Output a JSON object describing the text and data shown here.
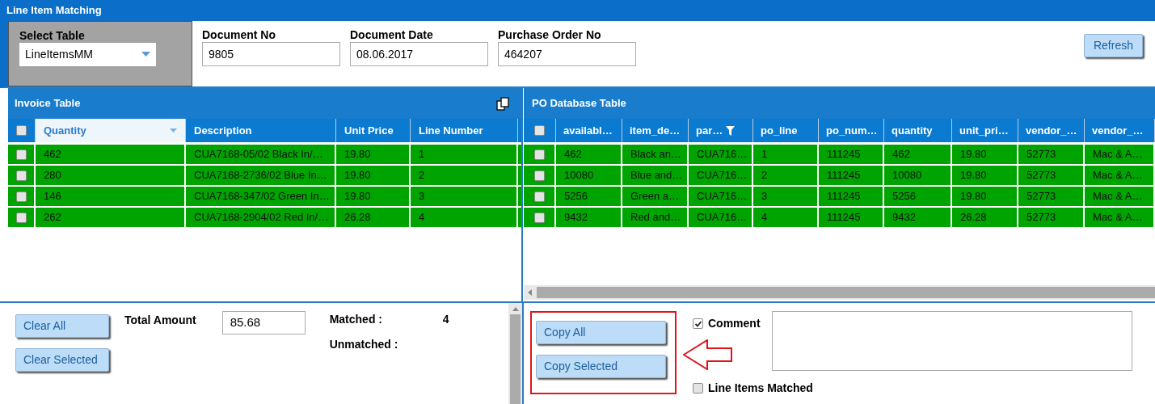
{
  "window": {
    "title": "Line Item Matching"
  },
  "select_table": {
    "label": "Select Table",
    "value": "LineItemsMM"
  },
  "fields": [
    {
      "label": "Document No",
      "value": "9805"
    },
    {
      "label": "Document Date",
      "value": "08.06.2017"
    },
    {
      "label": "Purchase Order No",
      "value": "464207"
    }
  ],
  "refresh_button": "Refresh",
  "invoice_table": {
    "title": "Invoice Table",
    "all_checked": false,
    "columns": [
      {
        "label": "Quantity",
        "active": true
      },
      {
        "label": "Description",
        "active": false
      },
      {
        "label": "Unit Price",
        "active": false
      },
      {
        "label": "Line Number",
        "active": false
      }
    ],
    "rows": [
      {
        "checked": false,
        "matched": true,
        "cells": [
          "462",
          "CUA7168-05/02 Black In/…",
          "19.80",
          "1"
        ]
      },
      {
        "checked": false,
        "matched": true,
        "cells": [
          "280",
          "CUA7168-2736/02 Blue In…",
          "19.80",
          "2"
        ]
      },
      {
        "checked": false,
        "matched": true,
        "cells": [
          "146",
          "CUA7168-347/02 Green In…",
          "19.80",
          "3"
        ]
      },
      {
        "checked": false,
        "matched": true,
        "cells": [
          "262",
          "CUA7168-2904/02 Red In/…",
          "26.28",
          "4"
        ]
      }
    ]
  },
  "po_table": {
    "title": "PO Database Table",
    "all_checked": false,
    "columns": [
      {
        "label": "availabl…",
        "filtered": false
      },
      {
        "label": "item_de…",
        "filtered": false
      },
      {
        "label": "par…",
        "filtered": true
      },
      {
        "label": "po_line",
        "filtered": false
      },
      {
        "label": "po_num…",
        "filtered": false
      },
      {
        "label": "quantity",
        "filtered": false
      },
      {
        "label": "unit_pri…",
        "filtered": false
      },
      {
        "label": "vendor_…",
        "filtered": false
      },
      {
        "label": "vendor_…",
        "filtered": false
      }
    ],
    "rows": [
      {
        "checked": false,
        "matched": true,
        "cells": [
          "462",
          "Black an…",
          "CUA716…",
          "1",
          "111245",
          "462",
          "19.80",
          "52773",
          "Mac & A…"
        ]
      },
      {
        "checked": false,
        "matched": true,
        "cells": [
          "10080",
          "Blue and…",
          "CUA716…",
          "2",
          "111245",
          "10080",
          "19.80",
          "52773",
          "Mac & A…"
        ]
      },
      {
        "checked": false,
        "matched": true,
        "cells": [
          "5256",
          "Green a…",
          "CUA716…",
          "3",
          "111245",
          "5256",
          "19.80",
          "52773",
          "Mac & A…"
        ]
      },
      {
        "checked": false,
        "matched": true,
        "cells": [
          "9432",
          "Red and…",
          "CUA716…",
          "4",
          "111245",
          "9432",
          "26.28",
          "52773",
          "Mac & A…"
        ]
      }
    ]
  },
  "left_footer": {
    "buttons": [
      "Clear All",
      "Clear Selected"
    ],
    "total_label": "Total Amount",
    "total_value": "85.68",
    "matched_label": "Matched :",
    "matched_value": "4",
    "unmatched_label": "Unmatched :"
  },
  "right_footer": {
    "buttons": [
      "Copy All",
      "Copy Selected"
    ],
    "comment": {
      "label": "Comment",
      "checked": true
    },
    "line_items_matched": {
      "label": "Line Items Matched",
      "checked": false
    }
  }
}
